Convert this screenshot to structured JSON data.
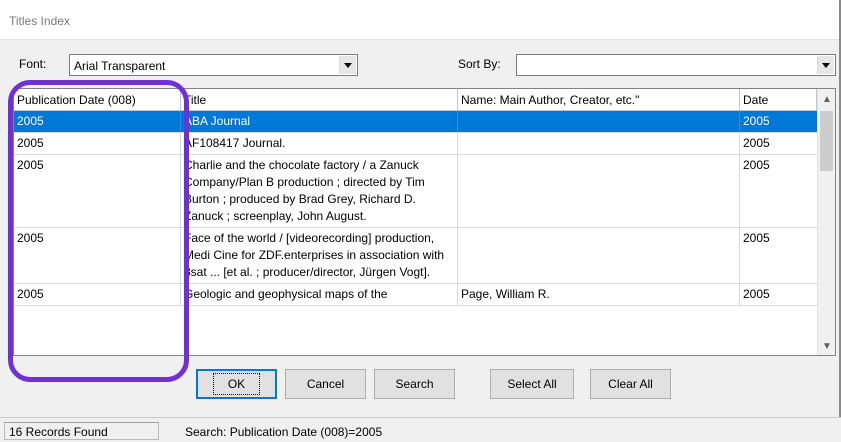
{
  "window": {
    "title": "Titles Index"
  },
  "font": {
    "label": "Font:",
    "value": "Arial Transparent"
  },
  "sort": {
    "label": "Sort By:",
    "value": ""
  },
  "list": {
    "columns": [
      "Publication Date (008)",
      "Title",
      "Name: Main Author, Creator, etc.\"",
      "Date"
    ],
    "rows": [
      [
        "2005",
        "ABA Journal",
        "",
        "2005"
      ],
      [
        "2005",
        "AF108417 Journal.",
        "",
        "2005"
      ],
      [
        "2005",
        "Charlie and the chocolate factory / a Zanuck Company/Plan B production ; directed by Tim Burton ; produced by Brad Grey, Richard D. Zanuck ; screenplay, John August.",
        "",
        "2005"
      ],
      [
        "2005",
        "Face of the world / [videorecording] production, Medi Cine for ZDF.enterprises in association with 3sat ... [et al. ; producer/director, Jürgen Vogt].",
        "",
        "2005"
      ],
      [
        "2005",
        "Geologic and geophysical maps of the",
        "Page, William R.",
        "2005"
      ]
    ]
  },
  "buttons": {
    "ok": "OK",
    "cancel": "Cancel",
    "search": "Search",
    "select_all": "Select All",
    "clear_all": "Clear All"
  },
  "status": {
    "records": "16 Records Found",
    "search": "Search: Publication Date (008)=2005"
  },
  "colors": {
    "selection": "#0078d7",
    "highlight": "#7030d8"
  }
}
